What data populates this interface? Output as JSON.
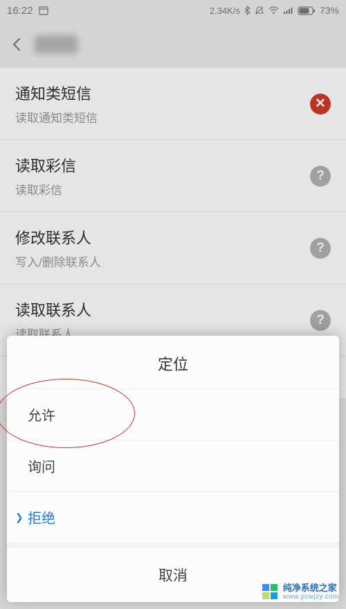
{
  "status": {
    "time": "16:22",
    "speed": "2.34K/s",
    "battery": "73%"
  },
  "list": {
    "items": [
      {
        "title": "通知类短信",
        "subtitle": "读取通知类短信",
        "badge": "red",
        "glyph": "✕"
      },
      {
        "title": "读取彩信",
        "subtitle": "读取彩信",
        "badge": "gray",
        "glyph": "?"
      },
      {
        "title": "修改联系人",
        "subtitle": "写入/删除联系人",
        "badge": "gray",
        "glyph": "?"
      },
      {
        "title": "读取联系人",
        "subtitle": "读取联系人",
        "badge": "gray",
        "glyph": "?"
      }
    ],
    "loc": {
      "title": "定位"
    }
  },
  "sheet": {
    "title": "定位",
    "options": {
      "allow": "允许",
      "ask": "询问",
      "deny": "拒绝"
    },
    "cancel": "取消"
  },
  "watermark": {
    "cn": "纯净系统之家",
    "url": "www.ycwjzy.com"
  }
}
